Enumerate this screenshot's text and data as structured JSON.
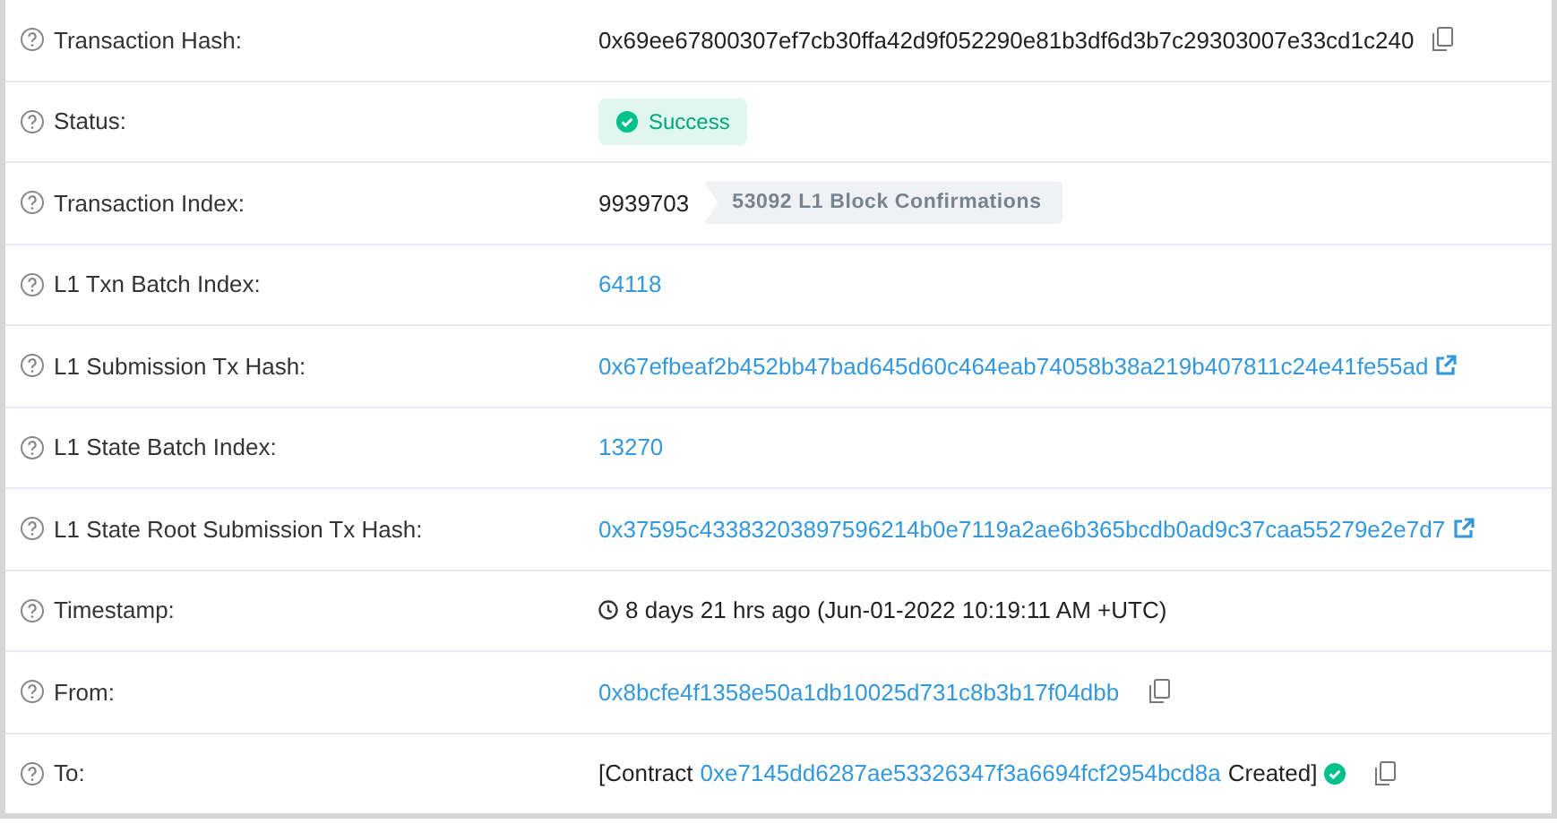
{
  "rows": [
    {
      "label": "Transaction Hash:",
      "kind": "copy",
      "value": "0x69ee67800307ef7cb30ffa42d9f052290e81b3df6d3b7c29303007e33cd1c240"
    },
    {
      "label": "Status:",
      "kind": "status",
      "value": "Success"
    },
    {
      "label": "Transaction Index:",
      "kind": "badge",
      "value": "9939703",
      "badge": "53092 L1 Block Confirmations"
    },
    {
      "label": "L1 Txn Batch Index:",
      "kind": "link",
      "value": "64118"
    },
    {
      "label": "L1 Submission Tx Hash:",
      "kind": "external",
      "value": "0x67efbeaf2b452bb47bad645d60c464eab74058b38a219b407811c24e41fe55ad"
    },
    {
      "label": "L1 State Batch Index:",
      "kind": "link",
      "value": "13270"
    },
    {
      "label": "L1 State Root Submission Tx Hash:",
      "kind": "external",
      "value": "0x37595c43383203897596214b0e7119a2ae6b365bcdb0ad9c37caa55279e2e7d7"
    },
    {
      "label": "Timestamp:",
      "kind": "time",
      "value": "8 days 21 hrs ago (Jun-01-2022 10:19:11 AM +UTC)"
    },
    {
      "label": "From:",
      "kind": "linkcopy",
      "value": "0x8bcfe4f1358e50a1db10025d731c8b3b17f04dbb"
    },
    {
      "label": "To:",
      "kind": "contract",
      "prefix": "[Contract",
      "value": "0xe7145dd6287ae53326347f3a6694fcf2954bcd8a",
      "suffix": "Created]"
    }
  ]
}
